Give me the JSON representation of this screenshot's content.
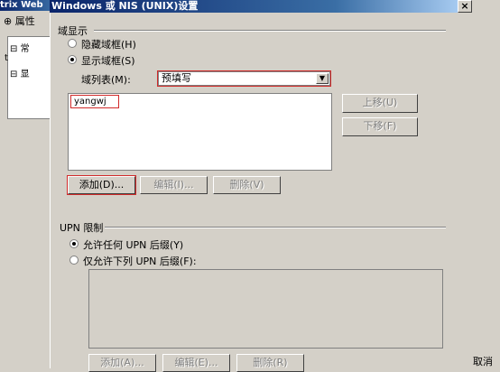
{
  "background_window": {
    "title": "trix Web",
    "tab": "属性",
    "tree": [
      "常",
      "t",
      "显"
    ]
  },
  "dialog": {
    "title": "Windows 或 NIS (UNIX)设置",
    "domain_display": {
      "group_label": "域显示",
      "hide_option": "隐藏域框(H)",
      "show_option": "显示域框(S)",
      "selected": "show",
      "domain_list_label": "域列表(M):",
      "domain_list_value": "预填写",
      "entries": [
        "yangwj"
      ],
      "move_up": "上移(U)",
      "move_down": "下移(F)",
      "add": "添加(D)...",
      "edit": "编辑(I)...",
      "delete": "删除(V)"
    },
    "upn": {
      "group_label": "UPN 限制",
      "allow_any": "允许任何 UPN 后缀(Y)",
      "allow_only": "仅允许下列 UPN 后缀(F):",
      "selected": "allow_any",
      "add": "添加(A)...",
      "edit": "编辑(E)...",
      "delete": "删除(R)"
    },
    "cancel_partial": "取消"
  }
}
